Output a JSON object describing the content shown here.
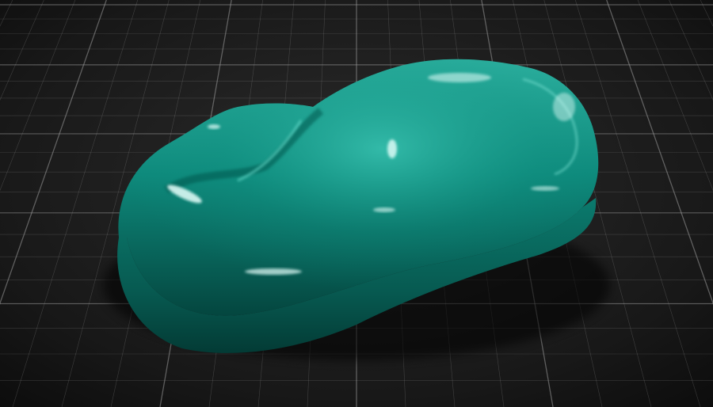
{
  "scene": {
    "subject": "paint-speed-shape",
    "colors": {
      "background": "#1c1c1c",
      "grid_line": "#9a9a9a",
      "paint_base": "#0e8a7c",
      "paint_light": "#2fb3a2",
      "paint_dark": "#04463f",
      "highlight": "#e6fffb"
    }
  }
}
